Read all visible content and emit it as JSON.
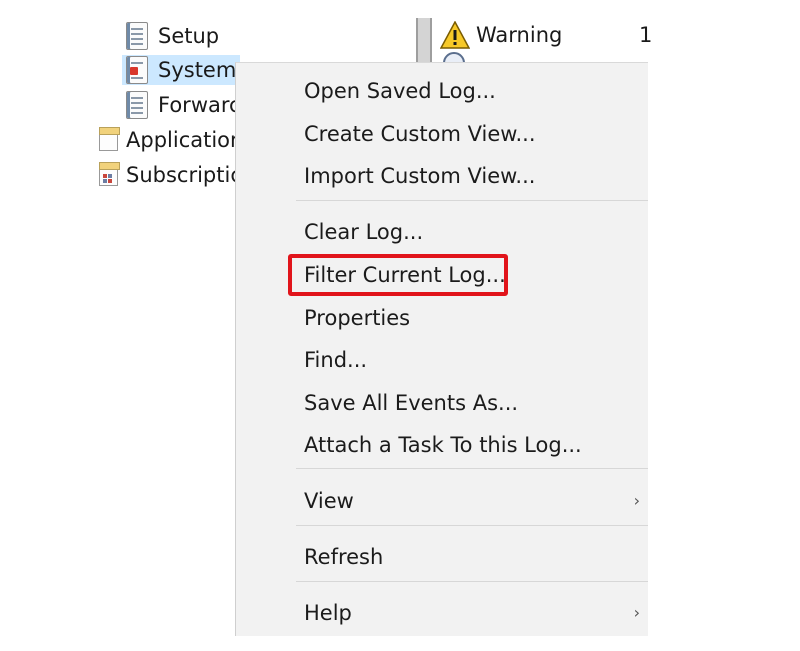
{
  "tree": {
    "items": [
      {
        "label": "Setup",
        "icon": "log-icon"
      },
      {
        "label": "System",
        "icon": "log-icon",
        "selected": true
      },
      {
        "label": "Forwarc",
        "icon": "log-icon"
      },
      {
        "label": "Applicatior",
        "icon": "folder-doc-icon"
      },
      {
        "label": "Subscriptic",
        "icon": "subscriptions-icon"
      }
    ]
  },
  "events_pane": {
    "level": "Warning",
    "count": "1"
  },
  "context_menu": {
    "open_saved_log": "Open Saved Log...",
    "create_custom_view": "Create Custom View...",
    "import_custom_view": "Import Custom View...",
    "clear_log": "Clear Log...",
    "filter_current_log": "Filter Current Log...",
    "properties": "Properties",
    "find": "Find...",
    "save_all_events_as": "Save All Events As...",
    "attach_task": "Attach a Task To this Log...",
    "view": "View",
    "refresh": "Refresh",
    "help": "Help",
    "submenu_chevron": "›"
  },
  "colors": {
    "highlight_box": "#e1141b",
    "menu_bg": "#f2f2f2",
    "selection_bg": "#cce8ff"
  }
}
